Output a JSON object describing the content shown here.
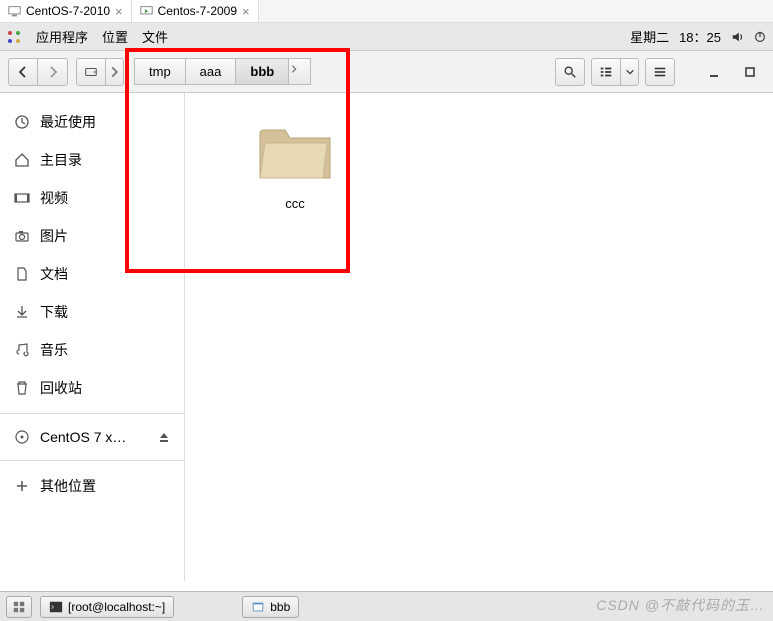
{
  "vmTabs": [
    {
      "label": "CentOS-7-2010",
      "active": false
    },
    {
      "label": "Centos-7-2009",
      "active": true
    }
  ],
  "menuBar": {
    "apps": "应用程序",
    "places": "位置",
    "files": "文件",
    "day": "星期二",
    "time": "18：25"
  },
  "breadcrumb": {
    "items": [
      "tmp",
      "aaa",
      "bbb"
    ],
    "activeIndex": 2
  },
  "sidebar": {
    "recent": "最近使用",
    "home": "主目录",
    "videos": "视频",
    "pictures": "图片",
    "documents": "文档",
    "downloads": "下载",
    "music": "音乐",
    "trash": "回收站",
    "disk": "CentOS 7 x…",
    "other": "其他位置"
  },
  "content": {
    "folder1": "ccc"
  },
  "taskbar": {
    "terminal": "[root@localhost:~]",
    "filemanager": "bbb"
  },
  "watermark": "CSDN @不敲代码的玉…"
}
